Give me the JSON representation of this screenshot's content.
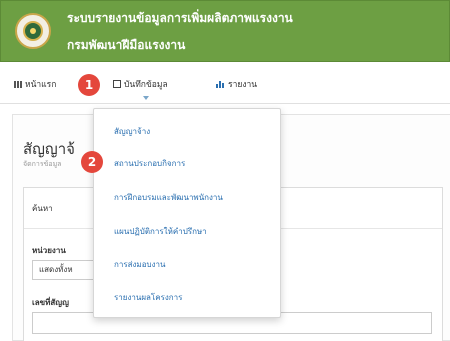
{
  "header": {
    "title": "ระบบรายงานข้อมูลการเพิ่มผลิตภาพแรงงาน",
    "subtitle": "กรมพัฒนาฝีมือแรงงาน"
  },
  "nav": {
    "home": "หน้าแรก",
    "record": "บันทึกข้อมูล",
    "report": "รายงาน"
  },
  "badges": {
    "first": "1",
    "second": "2"
  },
  "page": {
    "title": "สัญญาจ้",
    "subtitle": "จัดการข้อมูล"
  },
  "panel": {
    "search_label": "ค้นหา",
    "unit_label": "หน่วยงาน",
    "unit_value": "แสดงทั้งห",
    "contract_label": "เลขที่สัญญ"
  },
  "dropdown": {
    "items": [
      "สัญญาจ้าง",
      "สถานประกอบกิจการ",
      "การฝึกอบรมและพัฒนาพนักงาน",
      "แผนปฏิบัติการให้คำปรึกษา",
      "การส่งมอบงาน",
      "รายงานผลโครงการ"
    ]
  },
  "colors": {
    "header_green": "#6d9f43",
    "link_blue": "#2a6fb0",
    "badge_red": "#e4473c"
  },
  "icons": {
    "home": "grid-icon",
    "record": "edit-icon",
    "report": "chart-icon"
  }
}
